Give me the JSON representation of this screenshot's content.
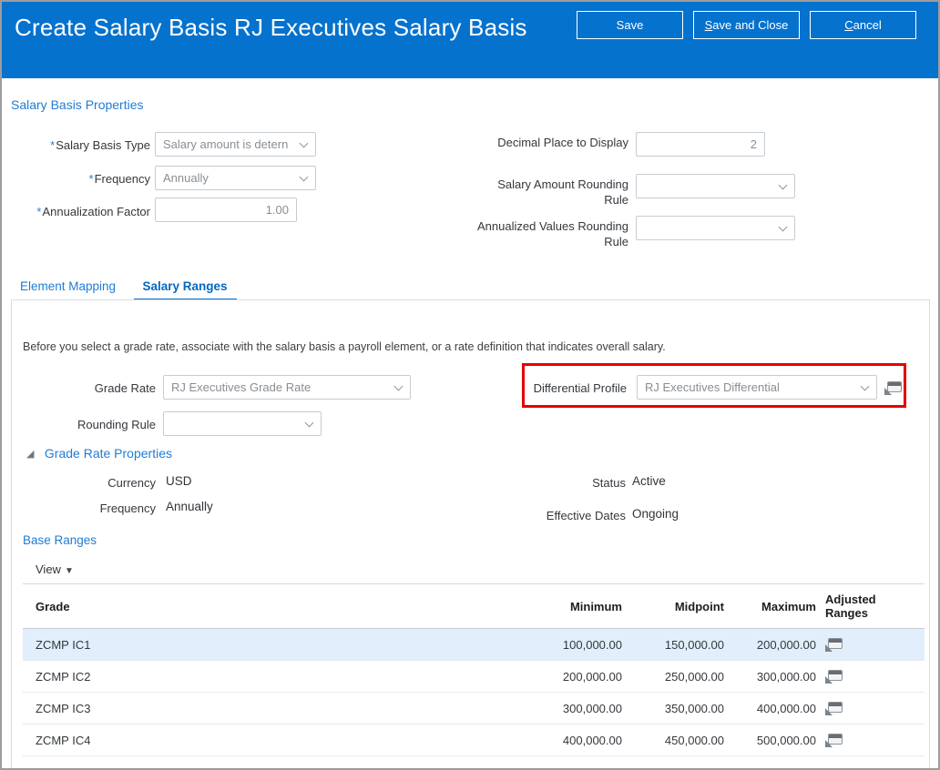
{
  "colors": {
    "banner_blue": "#0572CE",
    "link_blue": "#1F7CD4",
    "highlight_red": "#E60000",
    "selected_row_bg": "#E0EFFB"
  },
  "icons": {
    "dropdown_chevron": "chevron-down",
    "adjusted_ranges": "panel-with-arrow",
    "differential_profile_detail": "panel-with-arrow",
    "section_disclosure": "triangle-lower-right",
    "view_caret": "triangle-down"
  },
  "header": {
    "title": "Create Salary Basis RJ Executives Salary Basis",
    "buttons": {
      "save": "Save",
      "save_and_close": "Save and Close",
      "cancel": "Cancel"
    }
  },
  "properties_section": {
    "title": "Salary Basis Properties",
    "fields": {
      "salary_basis_type": {
        "label": "Salary Basis Type",
        "required": true,
        "value": "Salary amount is detern"
      },
      "frequency": {
        "label": "Frequency",
        "required": true,
        "value": "Annually"
      },
      "annualization_factor": {
        "label": "Annualization Factor",
        "required": true,
        "value": "1.00"
      },
      "decimal_place": {
        "label": "Decimal Place to Display",
        "value": "2"
      },
      "salary_amount_rounding": {
        "label": "Salary Amount Rounding Rule",
        "value": ""
      },
      "annualized_values_rounding": {
        "label": "Annualized Values Rounding Rule",
        "value": ""
      }
    }
  },
  "tabs": [
    {
      "label": "Element Mapping",
      "active": false
    },
    {
      "label": "Salary Ranges",
      "active": true
    }
  ],
  "salary_ranges": {
    "info_text": "Before you select a grade rate, associate with the salary basis a payroll element, or a rate definition that indicates overall salary.",
    "grade_rate": {
      "label": "Grade Rate",
      "value": "RJ Executives Grade Rate"
    },
    "rounding_rule": {
      "label": "Rounding Rule",
      "value": ""
    },
    "differential_profile": {
      "label": "Differential Profile",
      "value": "RJ Executives Differential"
    },
    "grade_rate_properties": {
      "title": "Grade Rate Properties",
      "currency": {
        "label": "Currency",
        "value": "USD"
      },
      "frequency": {
        "label": "Frequency",
        "value": "Annually"
      },
      "status": {
        "label": "Status",
        "value": "Active"
      },
      "effective_dates": {
        "label": "Effective Dates",
        "value": "Ongoing"
      }
    },
    "base_ranges": {
      "title": "Base Ranges",
      "view_menu": "View",
      "table": {
        "columns": {
          "grade": "Grade",
          "minimum": "Minimum",
          "midpoint": "Midpoint",
          "maximum": "Maximum",
          "adjusted_ranges": "Adjusted Ranges"
        },
        "rows": [
          {
            "grade": "ZCMP IC1",
            "minimum": "100,000.00",
            "midpoint": "150,000.00",
            "maximum": "200,000.00",
            "selected": true
          },
          {
            "grade": "ZCMP IC2",
            "minimum": "200,000.00",
            "midpoint": "250,000.00",
            "maximum": "300,000.00",
            "selected": false
          },
          {
            "grade": "ZCMP IC3",
            "minimum": "300,000.00",
            "midpoint": "350,000.00",
            "maximum": "400,000.00",
            "selected": false
          },
          {
            "grade": "ZCMP IC4",
            "minimum": "400,000.00",
            "midpoint": "450,000.00",
            "maximum": "500,000.00",
            "selected": false
          }
        ]
      }
    }
  }
}
